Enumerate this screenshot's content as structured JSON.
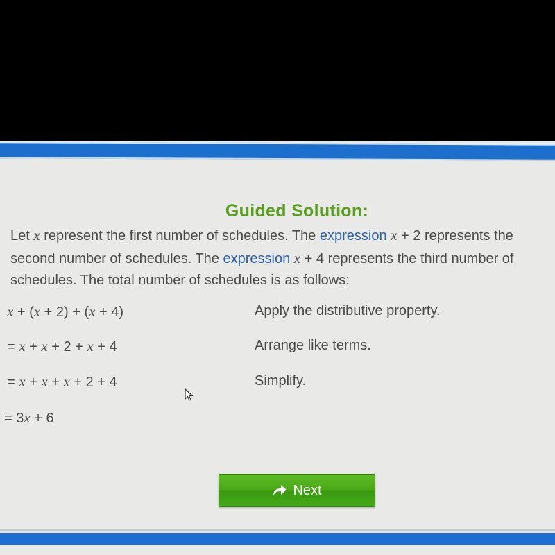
{
  "guided_solution": {
    "title": "Guided Solution:",
    "paragraph": {
      "line1": {
        "t1": "Let ",
        "v1": "x",
        "t2": " represent the first number of schedules. The ",
        "kw1": "expression",
        "t3": " ",
        "v2": "x",
        "t4": " + 2 represents the"
      },
      "line2": {
        "t1": "second number of schedules. The ",
        "kw1": "expression",
        "t2": " ",
        "v1": "x",
        "t3": " + 4 represents the third number of"
      },
      "line3": {
        "t1": "schedules. The total number of schedules is as follows:"
      }
    },
    "steps": [
      {
        "expression": [
          "x",
          " + (",
          "x",
          " + 2) + (",
          "x",
          " + 4)"
        ],
        "reason": "Apply the distributive property."
      },
      {
        "expression": [
          "= ",
          "x",
          " + ",
          "x",
          " + 2 + ",
          "x",
          " + 4"
        ],
        "reason": "Arrange like terms."
      },
      {
        "expression": [
          "= ",
          "x",
          " + ",
          "x",
          " + ",
          "x",
          " + 2 + 4"
        ],
        "reason": "Simplify."
      },
      {
        "expression": [
          "= 3",
          "x",
          " + 6"
        ],
        "reason": ""
      }
    ],
    "next_button": {
      "label": "Next",
      "icon": "forward-arrow-icon"
    }
  },
  "colors": {
    "title_green": "#5a9e1e",
    "keyword_blue": "#2a62a8",
    "bar_blue": "#1d6fce",
    "button_green": "#4aa818",
    "text_gray": "#4a4a4a"
  }
}
